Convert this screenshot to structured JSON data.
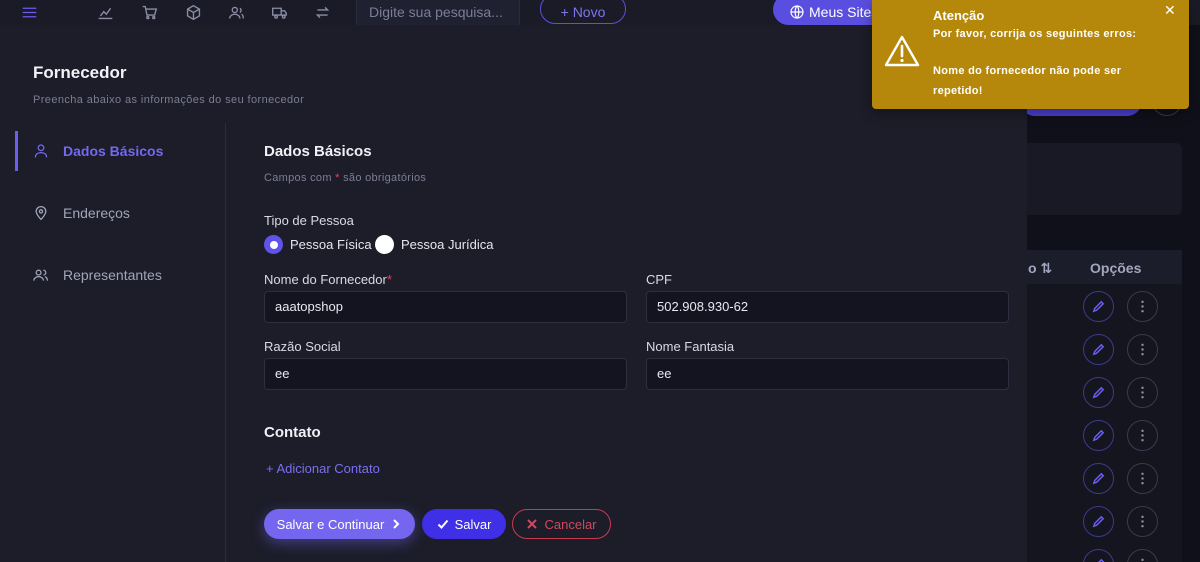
{
  "topbar": {
    "search_placeholder": "Digite sua pesquisa...",
    "new_label": "+ Novo",
    "sites_label": "Meus Sites"
  },
  "background_table": {
    "col_partial": "o ⇅",
    "col_options": "Opções"
  },
  "modal": {
    "title": "Fornecedor",
    "subtitle": "Preencha abaixo as informações do seu fornecedor",
    "sidebar": [
      {
        "label": "Dados Básicos",
        "icon": "user-icon",
        "active": true
      },
      {
        "label": "Endereços",
        "icon": "location-pin-icon",
        "active": false
      },
      {
        "label": "Representantes",
        "icon": "users-icon",
        "active": false
      }
    ],
    "section_title": "Dados Básicos",
    "required_hint_prefix": "Campos com ",
    "required_hint_star": "*",
    "required_hint_suffix": " são obrigatórios",
    "person_type_label": "Tipo de Pessoa",
    "person_types": [
      {
        "label": "Pessoa Física",
        "checked": true
      },
      {
        "label": "Pessoa Jurídica",
        "checked": false
      }
    ],
    "fields": {
      "supplier_name": {
        "label": "Nome do Fornecedor",
        "required_mark": "*",
        "value": "aaatopshop"
      },
      "cpf": {
        "label": "CPF",
        "value": "502.908.930-62"
      },
      "company_name": {
        "label": "Razão Social",
        "value": "ee"
      },
      "trade_name": {
        "label": "Nome Fantasia",
        "value": "ee"
      }
    },
    "contact_title": "Contato",
    "add_contact_label": "+ Adicionar Contato",
    "buttons": {
      "save_continue": "Salvar e Continuar",
      "save": "Salvar",
      "cancel": "Cancelar"
    }
  },
  "toast": {
    "title": "Atenção",
    "line1": "Por favor, corrija os seguintes erros:",
    "line2": "Nome do fornecedor não pode ser repetido!",
    "close_label": "✕",
    "color": "#b5870a"
  },
  "colors": {
    "accent": "#6b5ef0",
    "danger": "#d0485f",
    "background": "#1c1d29"
  }
}
